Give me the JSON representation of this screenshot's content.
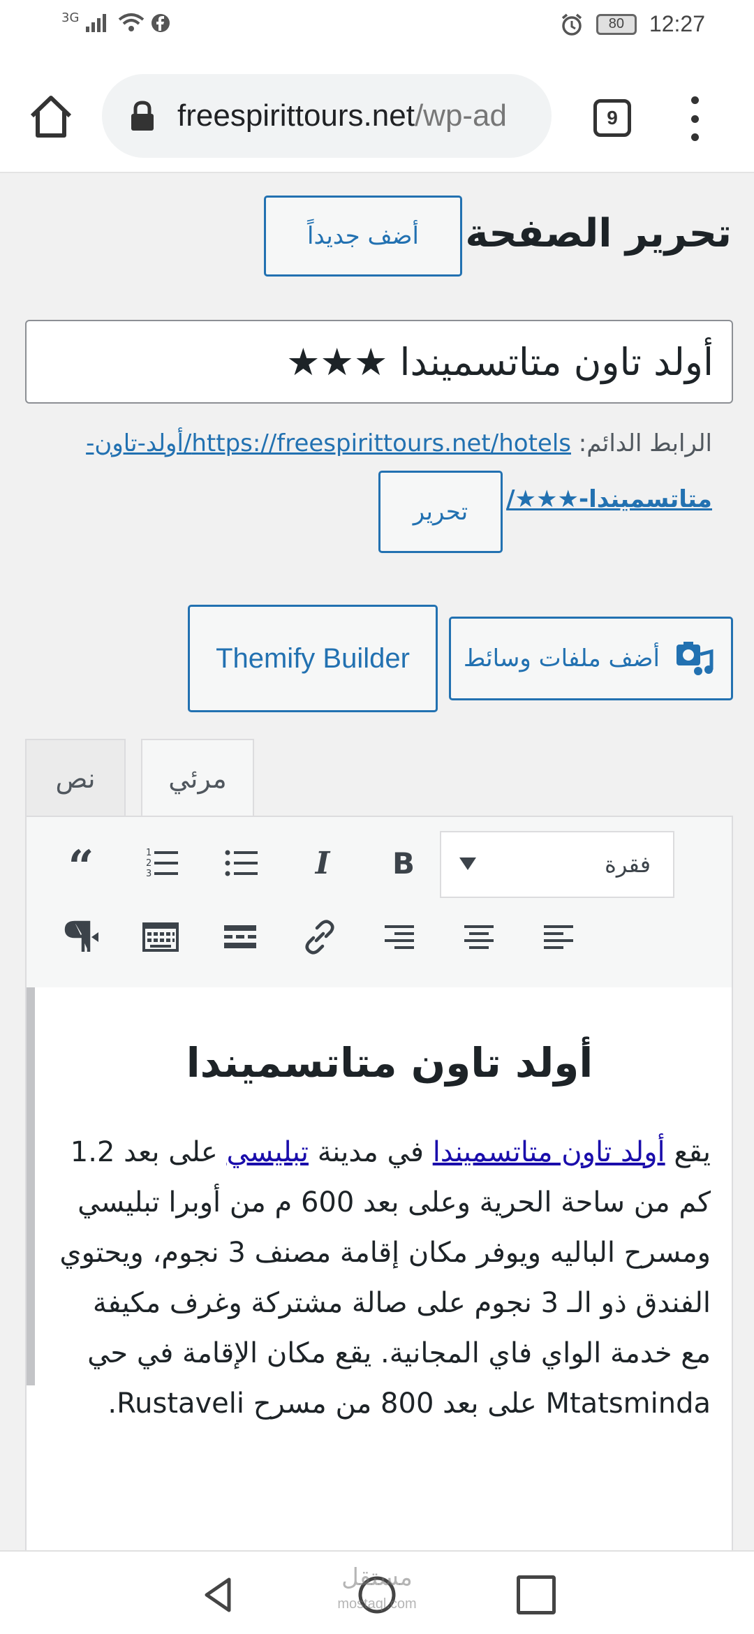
{
  "status_bar": {
    "network": "3G",
    "battery": "80",
    "time": "12:27"
  },
  "browser": {
    "url_main": "freespirittours.net",
    "url_path": "/wp-ad",
    "tab_count": "9"
  },
  "page": {
    "heading": "تحرير الصفحة",
    "add_new_label": "أضف جديداً",
    "title_value": "أولد تاون متاتسميندا ★★★",
    "permalink_label": "الرابط الدائم:",
    "permalink_url_1": "https://freespirittours.net/hotels/أولد-تاون-",
    "permalink_url_2": "متاتسميندا-★★★/",
    "edit_label": "تحرير",
    "add_media_label": "أضف ملفات وسائط",
    "themify_label": "Themify Builder"
  },
  "editor": {
    "tab_visual": "مرئي",
    "tab_text": "نص",
    "format_value": "فقرة",
    "content_heading": "أولد تاون متاتسميندا",
    "para_start": "يقع ",
    "para_link_1": "أولد تاون متاتسميندا",
    "para_mid_1": " في مدينة ",
    "para_link_2": "تبليسي",
    "para_rest": " على بعد 1.2 كم من ساحة الحرية وعلى بعد 600 م من أوبرا تبليسي ومسرح الباليه ويوفر مكان إقامة مصنف 3 نجوم، ويحتوي الفندق ذو الـ 3 نجوم على صالة مشتركة وغرف مكيفة مع خدمة الواي فاي المجانية. يقع مكان الإقامة في حي Mtatsminda على بعد 800 من مسرح Rustaveli."
  },
  "watermark": {
    "arabic": "مستقل",
    "latin": "mostaql.com"
  },
  "colors": {
    "accent": "#2271b1",
    "background": "#f1f1f1",
    "link": "#1a0dab"
  }
}
